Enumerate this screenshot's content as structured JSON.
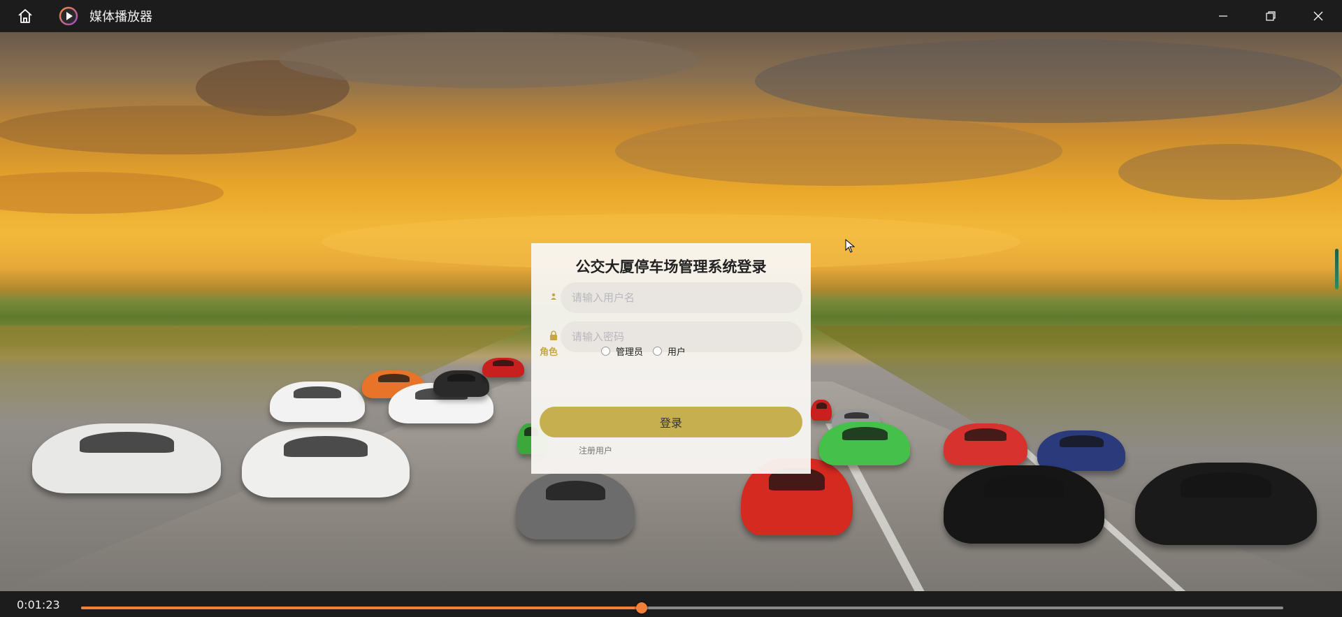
{
  "window": {
    "title": "媒体播放器",
    "icons": {
      "home": "home-icon",
      "app": "play-circle-icon",
      "minimize": "minimize-icon",
      "restore": "restore-icon",
      "close": "close-icon"
    }
  },
  "login": {
    "title": "公交大厦停车场管理系统登录",
    "username_placeholder": "请输入用户名",
    "password_placeholder": "请输入密码",
    "role_label": "角色",
    "roles": [
      "管理员",
      "用户"
    ],
    "login_button": "登录",
    "register_link": "注册用户",
    "accent_color": "#c6af4e"
  },
  "player": {
    "current_time": "0:01:23",
    "progress": 0.466,
    "progress_color": "#f2803a"
  }
}
